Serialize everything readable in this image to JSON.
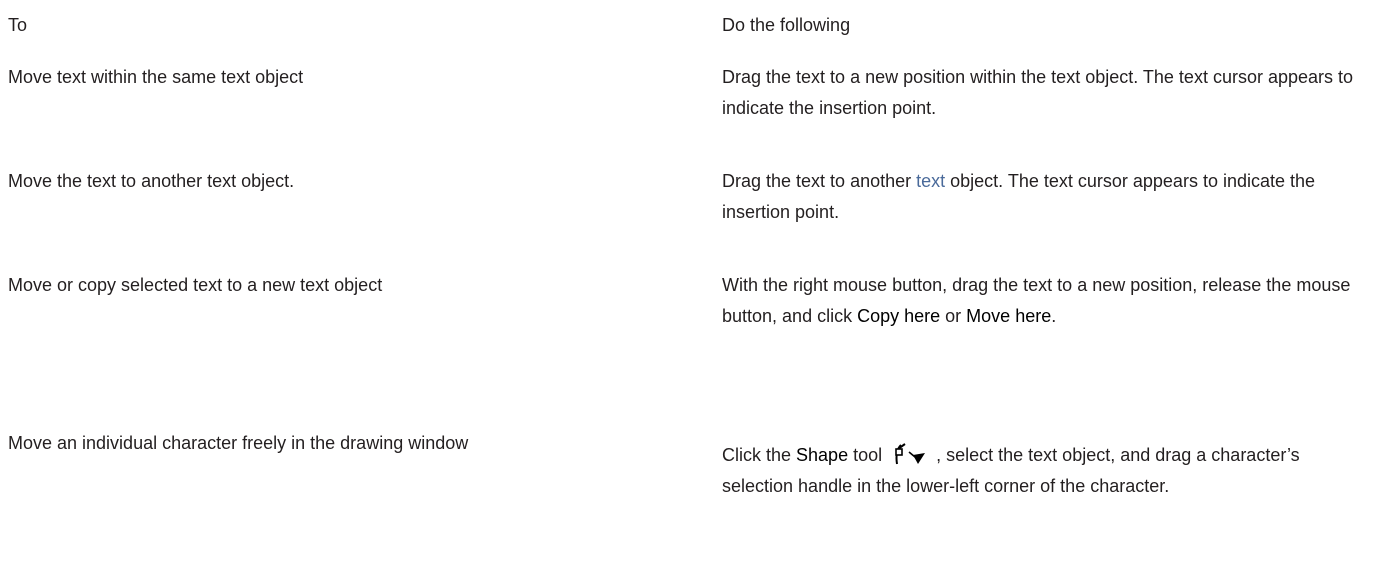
{
  "table": {
    "header": {
      "to": "To",
      "do": "Do the following"
    },
    "rows": [
      {
        "to": "Move text within the same text object",
        "do": "Drag the text to a new position within the text object. The text cursor appears to indicate the insertion point."
      },
      {
        "to": "Move the text to another text object.",
        "do_before": "Drag the text to another ",
        "do_link": "text",
        "do_after": " object. The text cursor appears to indicate the insertion point."
      },
      {
        "to": "Move or copy selected text to a new text object",
        "do_before": "With the right mouse button, drag the text to a new position, release the mouse button, and click ",
        "do_term1": "Copy here",
        "do_middle": " or ",
        "do_term2": "Move here",
        "do_after": "."
      },
      {
        "to": "Move an individual character freely in the drawing window",
        "do_before": "Click the ",
        "do_term": "Shape",
        "do_middle": " tool",
        "do_icon": "shape-tool-icon",
        "do_after": ", select the text object, and drag a character’s selection handle in the lower-left corner of the character."
      }
    ]
  },
  "colors": {
    "text": "#231f20",
    "link": "#4a6a9a"
  }
}
